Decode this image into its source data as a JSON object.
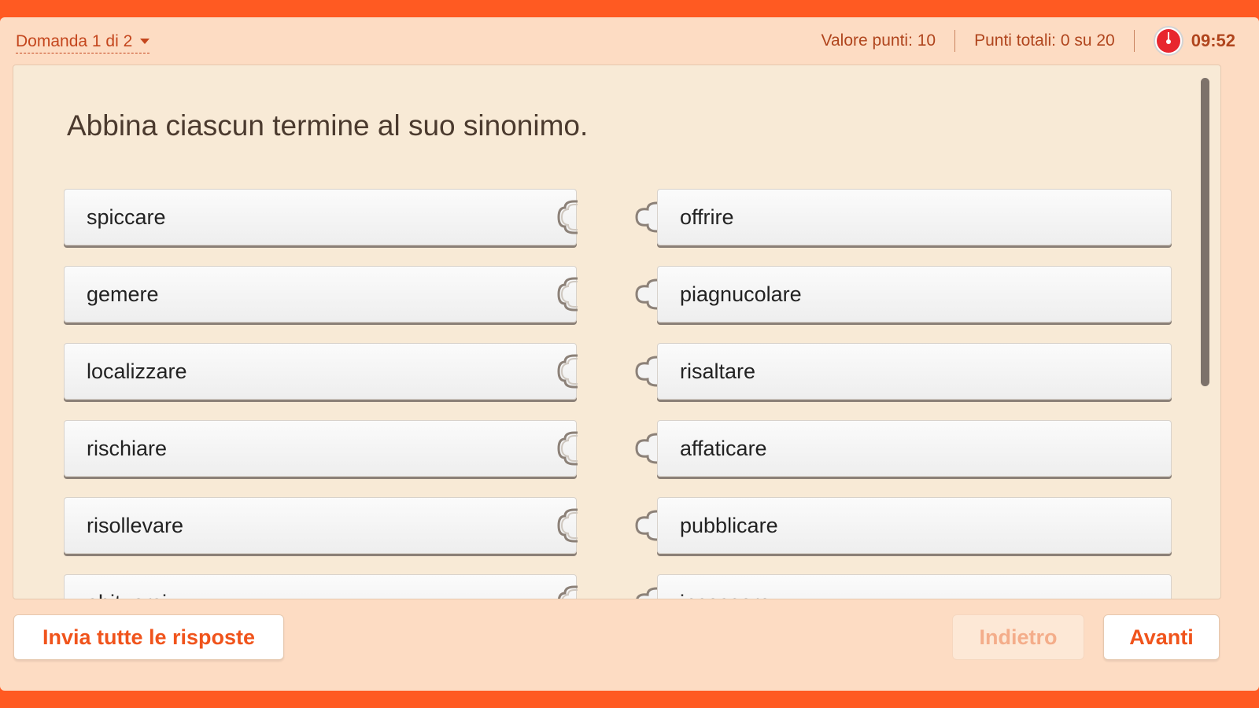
{
  "header": {
    "question_nav": "Domanda 1 di 2",
    "points_value": "Valore punti: 10",
    "total_points": "Punti totali: 0 su 20",
    "timer": "09:52"
  },
  "question": {
    "prompt": "Abbina ciascun termine al suo sinonimo."
  },
  "left_items": [
    {
      "label": "spiccare"
    },
    {
      "label": "gemere"
    },
    {
      "label": "localizzare"
    },
    {
      "label": "rischiare"
    },
    {
      "label": "risollevare"
    },
    {
      "label": "abituarsi"
    }
  ],
  "right_items": [
    {
      "label": "offrire"
    },
    {
      "label": "piagnucolare"
    },
    {
      "label": "risaltare"
    },
    {
      "label": "affaticare"
    },
    {
      "label": "pubblicare"
    },
    {
      "label": "incassare"
    }
  ],
  "footer": {
    "submit_label": "Invia tutte le risposte",
    "back_label": "Indietro",
    "next_label": "Avanti"
  },
  "colors": {
    "accent": "#ff5a22",
    "timer": "#e8262e"
  }
}
